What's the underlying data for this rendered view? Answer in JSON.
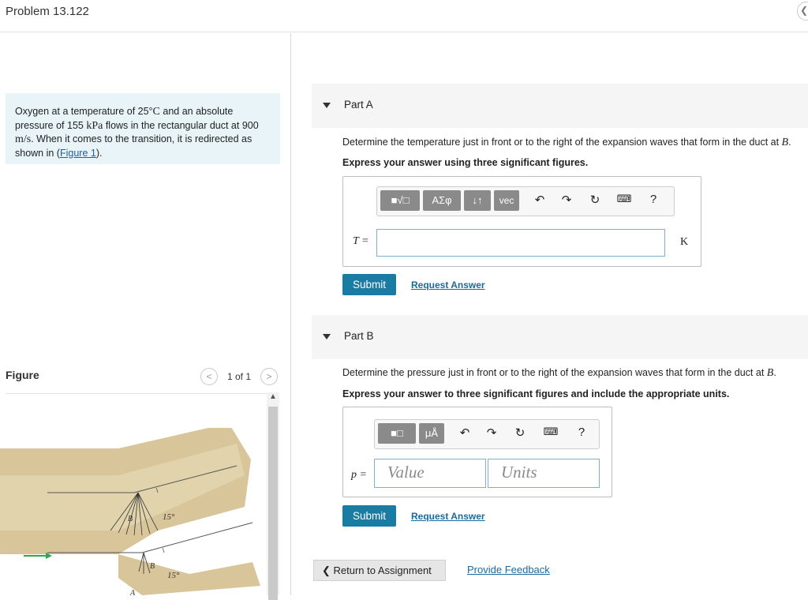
{
  "page": {
    "title": "Problem 13.122"
  },
  "problem": {
    "p1": "Oxygen at a temperature of 25",
    "deg": "°",
    "unit_C": "C",
    "p2": " and an absolute pressure of 155 ",
    "unit_kPa": "kPa",
    "p3": " flows in the rectangular duct at 900 ",
    "unit_ms": "m/s",
    "p4": ". When it comes to the transition, it is redirected as shown in (",
    "figure_link": "Figure 1",
    "p5": ")."
  },
  "figure": {
    "label": "Figure",
    "count": "1 of 1",
    "prev": "<",
    "next": ">",
    "scroll_up": "▲",
    "angle_top": "15°",
    "angle_bottom": "15°",
    "point_B_top": "B",
    "point_B_bottom": "B",
    "point_A": "A"
  },
  "partA": {
    "title": "Part A",
    "prompt": "Determine the temperature just in front or to the right of the expansion waves that form in the duct at ",
    "prompt_var": "B",
    "prompt_end": ".",
    "instruction": "Express your answer using three significant figures.",
    "toolbar": {
      "templates": "■√□",
      "greek": "ΑΣφ",
      "arrows": "↓↑",
      "vec": "vec",
      "help": "?"
    },
    "var": "T =",
    "unit": "K",
    "submit": "Submit",
    "request": "Request Answer"
  },
  "partB": {
    "title": "Part B",
    "prompt": "Determine the pressure just in front or to the right of the expansion waves that form in the duct at ",
    "prompt_var": "B",
    "prompt_end": ".",
    "instruction": "Express your answer to three significant figures and include the appropriate units.",
    "toolbar": {
      "templates": "■□",
      "units": "μÅ",
      "help": "?"
    },
    "var": "p =",
    "value_placeholder": "Value",
    "units_placeholder": "Units",
    "submit": "Submit",
    "request": "Request Answer"
  },
  "footer": {
    "return": "❮ Return to Assignment",
    "feedback": "Provide Feedback"
  },
  "colors": {
    "accent": "#1a7ba3",
    "problem_bg": "#e8f4f8",
    "duct": "#d8c69a",
    "arrow": "#2aa84a"
  }
}
